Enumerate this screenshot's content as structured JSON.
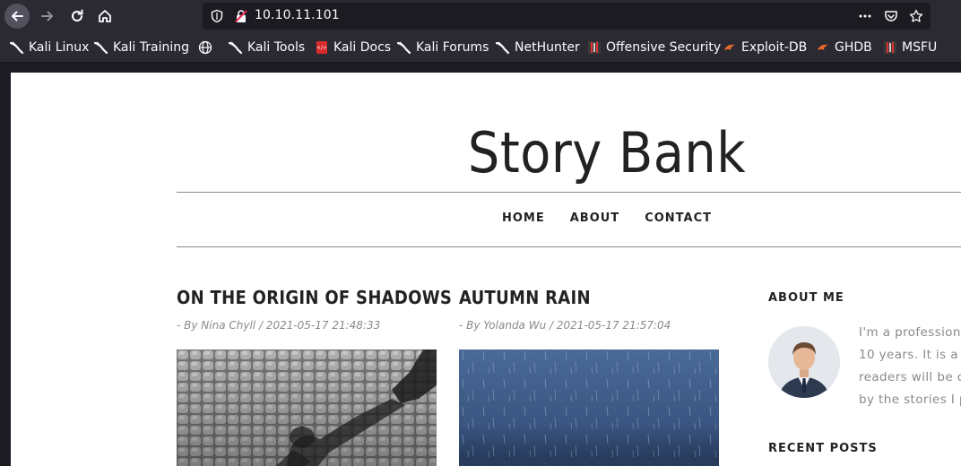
{
  "browser": {
    "url": "10.10.11.101",
    "bookmarks": [
      {
        "label": "Kali Linux",
        "icon": "kali-dragon-icon"
      },
      {
        "label": "Kali Training",
        "icon": "kali-dragon-icon"
      },
      {
        "label": "",
        "icon": "globe-icon"
      },
      {
        "label": "Kali Tools",
        "icon": "kali-dragon-icon"
      },
      {
        "label": "Kali Docs",
        "icon": "kali-docs-icon"
      },
      {
        "label": "Kali Forums",
        "icon": "kali-dragon-icon"
      },
      {
        "label": "NetHunter",
        "icon": "kali-dragon-icon"
      },
      {
        "label": "Offensive Security",
        "icon": "offsec-icon"
      },
      {
        "label": "Exploit-DB",
        "icon": "exploitdb-icon"
      },
      {
        "label": "GHDB",
        "icon": "exploitdb-icon"
      },
      {
        "label": "MSFU",
        "icon": "offsec-icon"
      }
    ]
  },
  "site": {
    "title": "Story Bank",
    "nav": [
      "HOME",
      "ABOUT",
      "CONTACT"
    ]
  },
  "posts": [
    {
      "title": "ON THE ORIGIN OF SHADOWS",
      "meta": "- By Nina Chyll / 2021-05-17 21:48:33"
    },
    {
      "title": "AUTUMN RAIN",
      "meta": "- By Yolanda Wu / 2021-05-17 21:57:04"
    }
  ],
  "sidebar": {
    "about_heading": "ABOUT ME",
    "about_lines": [
      "I'm a profession",
      "10 years. It is a",
      "readers will be c",
      "by the stories I p"
    ],
    "recent_heading": "RECENT POSTS"
  }
}
